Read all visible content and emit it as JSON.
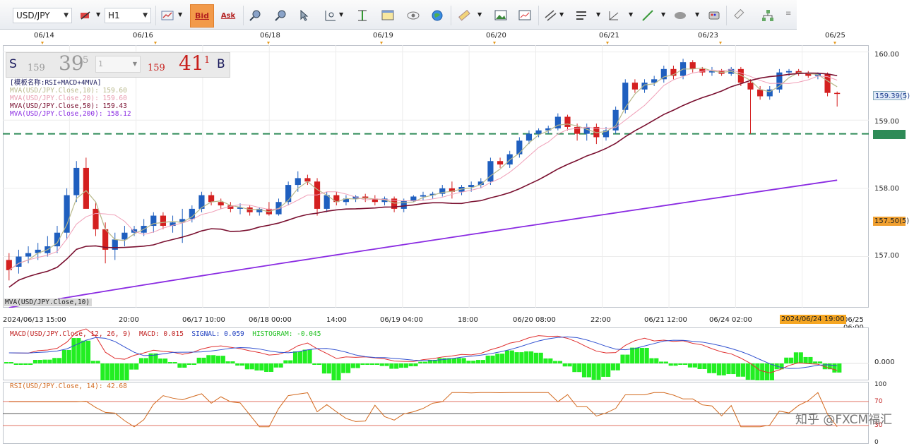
{
  "toolbar": {
    "symbol": "USD/JPY",
    "timeframe": "H1",
    "bid_label": "Bid",
    "ask_label": "Ask"
  },
  "top_dates": [
    "06/14",
    "06/16",
    "06/18",
    "06/19",
    "06/20",
    "06/21",
    "06/23",
    "06/25"
  ],
  "quote": {
    "sell_label": "S",
    "sell_prefix": "159",
    "sell_big": "39",
    "sell_pip": "5",
    "amount": "1",
    "buy_prefix": "159",
    "buy_big": "41",
    "buy_pip": "1",
    "buy_label": "B"
  },
  "legend": {
    "template": "[模板名称:RSI+MACD+4MVA]",
    "mva10": "MVA(USD/JPY.Close,10): 159.60",
    "mva20": "MVA(USD/JPY.Close,20): 159.60",
    "mva50": "MVA(USD/JPY.Close,50): 159.43",
    "mva200": "MVA(USD/JPY.Close,200): 158.12",
    "bottom_tag": "MVA(USD/JPY.Close,10)"
  },
  "y_axis": {
    "ticks": [
      "160.00",
      "159.00",
      "158.00",
      "157.00"
    ],
    "current_price": "159.39(5)",
    "level_tag": "157.50(5)",
    "hline_tag": "158.80"
  },
  "x_axis": {
    "labels": [
      "2024/06/13 15:00",
      "20:00",
      "06/17 10:00",
      "06/18 00:00",
      "14:00",
      "06/19 04:00",
      "18:00",
      "06/20 08:00",
      "22:00",
      "06/21 12:00",
      "06/24 02:00",
      "06/25 06:00"
    ],
    "cursor_label": "2024/06/24 19:00"
  },
  "macd": {
    "label_title": "MACD(USD/JPY.Close, 12, 26, 9)",
    "label_macd": "MACD: 0.015",
    "label_signal": "SIGNAL: 0.059",
    "label_hist": "HISTOGRAM: -0.045",
    "zero_tick": "0.000"
  },
  "rsi": {
    "label": "RSI(USD/JPY.Close, 14): 42.68",
    "ticks": [
      "100",
      "70",
      "30",
      "0"
    ]
  },
  "watermark": "知乎 @FXCM福汇",
  "colors": {
    "up": "#1f5fbf",
    "down": "#d42020",
    "mva10": "#b8b88a",
    "mva20": "#f0a0b8",
    "mva50": "#7a1030",
    "mva200": "#8a2be2",
    "hline": "#2e8b57",
    "macd_line": "#e03030",
    "signal_line": "#3050d0",
    "histogram": "#22ee22"
  },
  "chart_data": {
    "type": "candlestick",
    "ylim": [
      156.25,
      160.1
    ],
    "horizontal_line": 158.8,
    "candles": [
      {
        "o": 156.95,
        "h": 157.05,
        "l": 156.65,
        "c": 156.8
      },
      {
        "o": 156.85,
        "h": 157.1,
        "l": 156.75,
        "c": 157.0
      },
      {
        "o": 157.0,
        "h": 157.15,
        "l": 156.9,
        "c": 157.05
      },
      {
        "o": 157.05,
        "h": 157.2,
        "l": 156.95,
        "c": 157.1
      },
      {
        "o": 157.05,
        "h": 157.3,
        "l": 157.0,
        "c": 157.15
      },
      {
        "o": 157.15,
        "h": 157.45,
        "l": 157.05,
        "c": 157.35
      },
      {
        "o": 157.35,
        "h": 158.0,
        "l": 157.25,
        "c": 157.9
      },
      {
        "o": 157.9,
        "h": 158.4,
        "l": 157.8,
        "c": 158.3
      },
      {
        "o": 158.3,
        "h": 158.45,
        "l": 157.8,
        "c": 157.7
      },
      {
        "o": 157.7,
        "h": 157.8,
        "l": 157.3,
        "c": 157.4
      },
      {
        "o": 157.4,
        "h": 157.5,
        "l": 156.9,
        "c": 157.1
      },
      {
        "o": 157.1,
        "h": 157.35,
        "l": 156.95,
        "c": 157.25
      },
      {
        "o": 157.25,
        "h": 157.45,
        "l": 157.15,
        "c": 157.35
      },
      {
        "o": 157.35,
        "h": 157.45,
        "l": 157.3,
        "c": 157.4
      },
      {
        "o": 157.35,
        "h": 157.55,
        "l": 157.3,
        "c": 157.45
      },
      {
        "o": 157.45,
        "h": 157.65,
        "l": 157.35,
        "c": 157.6
      },
      {
        "o": 157.6,
        "h": 157.65,
        "l": 157.4,
        "c": 157.45
      },
      {
        "o": 157.45,
        "h": 157.6,
        "l": 157.35,
        "c": 157.5
      },
      {
        "o": 157.5,
        "h": 157.7,
        "l": 157.2,
        "c": 157.55
      },
      {
        "o": 157.55,
        "h": 157.75,
        "l": 157.5,
        "c": 157.7
      },
      {
        "o": 157.7,
        "h": 157.95,
        "l": 157.65,
        "c": 157.9
      },
      {
        "o": 157.9,
        "h": 157.95,
        "l": 157.75,
        "c": 157.8
      },
      {
        "o": 157.8,
        "h": 157.85,
        "l": 157.7,
        "c": 157.75
      },
      {
        "o": 157.75,
        "h": 157.8,
        "l": 157.65,
        "c": 157.7
      },
      {
        "o": 157.7,
        "h": 157.78,
        "l": 157.62,
        "c": 157.72
      },
      {
        "o": 157.72,
        "h": 157.75,
        "l": 157.6,
        "c": 157.65
      },
      {
        "o": 157.65,
        "h": 157.72,
        "l": 157.6,
        "c": 157.7
      },
      {
        "o": 157.7,
        "h": 157.8,
        "l": 157.6,
        "c": 157.62
      },
      {
        "o": 157.62,
        "h": 157.85,
        "l": 157.6,
        "c": 157.8
      },
      {
        "o": 157.8,
        "h": 158.1,
        "l": 157.75,
        "c": 158.05
      },
      {
        "o": 158.05,
        "h": 158.25,
        "l": 157.95,
        "c": 158.15
      },
      {
        "o": 158.15,
        "h": 158.2,
        "l": 158.05,
        "c": 158.1
      },
      {
        "o": 158.1,
        "h": 158.15,
        "l": 157.6,
        "c": 157.7
      },
      {
        "o": 157.7,
        "h": 157.95,
        "l": 157.65,
        "c": 157.9
      },
      {
        "o": 157.9,
        "h": 157.95,
        "l": 157.75,
        "c": 157.8
      },
      {
        "o": 157.8,
        "h": 157.9,
        "l": 157.75,
        "c": 157.85
      },
      {
        "o": 157.85,
        "h": 157.9,
        "l": 157.8,
        "c": 157.88
      },
      {
        "o": 157.88,
        "h": 157.92,
        "l": 157.8,
        "c": 157.85
      },
      {
        "o": 157.85,
        "h": 157.9,
        "l": 157.75,
        "c": 157.8
      },
      {
        "o": 157.8,
        "h": 157.88,
        "l": 157.75,
        "c": 157.85
      },
      {
        "o": 157.85,
        "h": 157.88,
        "l": 157.65,
        "c": 157.7
      },
      {
        "o": 157.7,
        "h": 157.85,
        "l": 157.65,
        "c": 157.82
      },
      {
        "o": 157.82,
        "h": 157.9,
        "l": 157.8,
        "c": 157.88
      },
      {
        "o": 157.88,
        "h": 157.95,
        "l": 157.82,
        "c": 157.9
      },
      {
        "o": 157.9,
        "h": 157.95,
        "l": 157.85,
        "c": 157.92
      },
      {
        "o": 157.92,
        "h": 158.05,
        "l": 157.88,
        "c": 158.0
      },
      {
        "o": 158.0,
        "h": 158.1,
        "l": 157.85,
        "c": 157.95
      },
      {
        "o": 157.95,
        "h": 158.05,
        "l": 157.9,
        "c": 158.02
      },
      {
        "o": 158.02,
        "h": 158.1,
        "l": 157.95,
        "c": 158.05
      },
      {
        "o": 158.05,
        "h": 158.15,
        "l": 158.0,
        "c": 158.1
      },
      {
        "o": 158.1,
        "h": 158.45,
        "l": 158.05,
        "c": 158.4
      },
      {
        "o": 158.4,
        "h": 158.45,
        "l": 158.3,
        "c": 158.35
      },
      {
        "o": 158.35,
        "h": 158.55,
        "l": 158.3,
        "c": 158.5
      },
      {
        "o": 158.5,
        "h": 158.75,
        "l": 158.45,
        "c": 158.7
      },
      {
        "o": 158.7,
        "h": 158.85,
        "l": 158.65,
        "c": 158.8
      },
      {
        "o": 158.8,
        "h": 158.88,
        "l": 158.75,
        "c": 158.85
      },
      {
        "o": 158.85,
        "h": 158.92,
        "l": 158.8,
        "c": 158.88
      },
      {
        "o": 158.88,
        "h": 159.1,
        "l": 158.85,
        "c": 159.05
      },
      {
        "o": 159.05,
        "h": 159.08,
        "l": 158.85,
        "c": 158.9
      },
      {
        "o": 158.9,
        "h": 158.95,
        "l": 158.7,
        "c": 158.8
      },
      {
        "o": 158.8,
        "h": 158.95,
        "l": 158.7,
        "c": 158.9
      },
      {
        "o": 158.9,
        "h": 158.95,
        "l": 158.65,
        "c": 158.75
      },
      {
        "o": 158.75,
        "h": 158.9,
        "l": 158.7,
        "c": 158.85
      },
      {
        "o": 158.85,
        "h": 159.2,
        "l": 158.8,
        "c": 159.15
      },
      {
        "o": 159.15,
        "h": 159.6,
        "l": 159.1,
        "c": 159.55
      },
      {
        "o": 159.55,
        "h": 159.6,
        "l": 159.4,
        "c": 159.45
      },
      {
        "o": 159.45,
        "h": 159.6,
        "l": 159.4,
        "c": 159.55
      },
      {
        "o": 159.55,
        "h": 159.65,
        "l": 159.5,
        "c": 159.6
      },
      {
        "o": 159.6,
        "h": 159.8,
        "l": 159.55,
        "c": 159.75
      },
      {
        "o": 159.75,
        "h": 159.8,
        "l": 159.6,
        "c": 159.65
      },
      {
        "o": 159.65,
        "h": 159.9,
        "l": 159.6,
        "c": 159.85
      },
      {
        "o": 159.85,
        "h": 159.88,
        "l": 159.7,
        "c": 159.75
      },
      {
        "o": 159.75,
        "h": 159.78,
        "l": 159.65,
        "c": 159.7
      },
      {
        "o": 159.7,
        "h": 159.78,
        "l": 159.65,
        "c": 159.72
      },
      {
        "o": 159.72,
        "h": 159.75,
        "l": 159.65,
        "c": 159.68
      },
      {
        "o": 159.68,
        "h": 159.78,
        "l": 159.65,
        "c": 159.75
      },
      {
        "o": 159.75,
        "h": 159.78,
        "l": 159.5,
        "c": 159.55
      },
      {
        "o": 159.55,
        "h": 159.6,
        "l": 158.8,
        "c": 159.45
      },
      {
        "o": 159.45,
        "h": 159.5,
        "l": 159.3,
        "c": 159.35
      },
      {
        "o": 159.35,
        "h": 159.5,
        "l": 159.3,
        "c": 159.45
      },
      {
        "o": 159.45,
        "h": 159.75,
        "l": 159.4,
        "c": 159.7
      },
      {
        "o": 159.7,
        "h": 159.75,
        "l": 159.65,
        "c": 159.72
      },
      {
        "o": 159.72,
        "h": 159.75,
        "l": 159.65,
        "c": 159.68
      },
      {
        "o": 159.68,
        "h": 159.72,
        "l": 159.62,
        "c": 159.65
      },
      {
        "o": 159.65,
        "h": 159.7,
        "l": 159.6,
        "c": 159.68
      },
      {
        "o": 159.68,
        "h": 159.7,
        "l": 159.35,
        "c": 159.4
      },
      {
        "o": 159.4,
        "h": 159.42,
        "l": 159.2,
        "c": 159.39
      }
    ]
  }
}
